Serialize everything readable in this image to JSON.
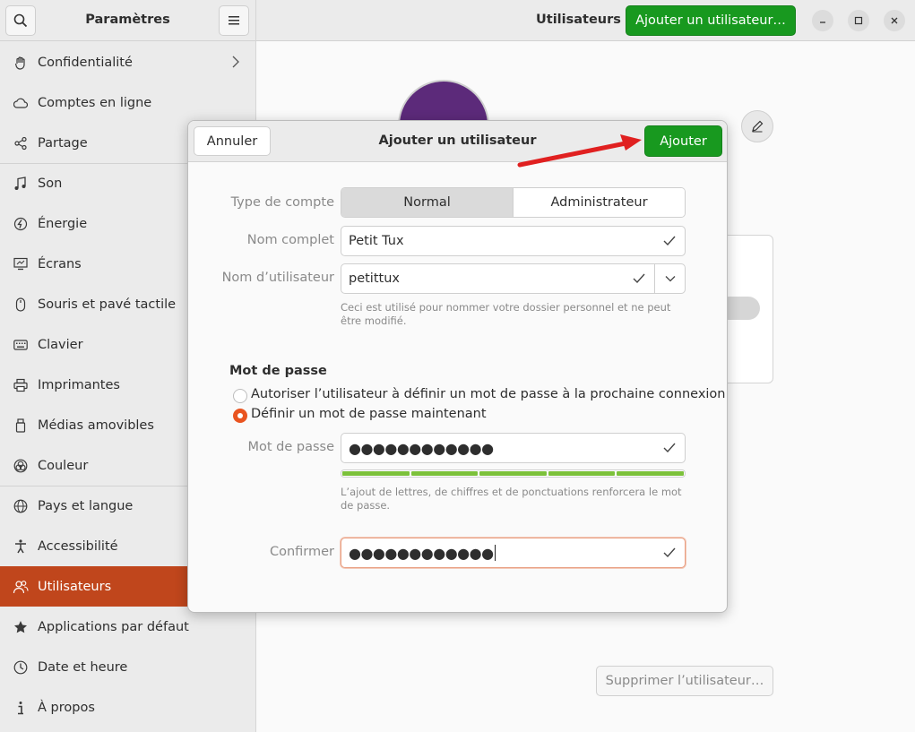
{
  "sidebar": {
    "title": "Paramètres",
    "items": [
      {
        "label": "Confidentialité",
        "icon": "hand-icon"
      },
      {
        "label": "Comptes en ligne",
        "icon": "cloud-icon"
      },
      {
        "label": "Partage",
        "icon": "share-icon"
      },
      {
        "label": "Son",
        "icon": "music-note-icon"
      },
      {
        "label": "Énergie",
        "icon": "power-icon"
      },
      {
        "label": "Écrans",
        "icon": "display-icon"
      },
      {
        "label": "Souris et pavé tactile",
        "icon": "mouse-icon"
      },
      {
        "label": "Clavier",
        "icon": "keyboard-icon"
      },
      {
        "label": "Imprimantes",
        "icon": "printer-icon"
      },
      {
        "label": "Médias amovibles",
        "icon": "usb-icon"
      },
      {
        "label": "Couleur",
        "icon": "color-icon"
      },
      {
        "label": "Pays et langue",
        "icon": "globe-icon"
      },
      {
        "label": "Accessibilité",
        "icon": "accessibility-icon"
      },
      {
        "label": "Utilisateurs",
        "icon": "users-icon"
      },
      {
        "label": "Applications par défaut",
        "icon": "star-icon"
      },
      {
        "label": "Date et heure",
        "icon": "clock-icon"
      },
      {
        "label": "À propos",
        "icon": "info-icon"
      }
    ]
  },
  "header": {
    "title": "Utilisateurs",
    "add_user_label": "Ajouter un utilisateur…"
  },
  "main": {
    "delete_user_label": "Supprimer l’utilisateur…"
  },
  "dialog": {
    "title": "Ajouter un utilisateur",
    "cancel_label": "Annuler",
    "ok_label": "Ajouter",
    "account_type_label": "Type de compte",
    "account_types": [
      "Normal",
      "Administrateur"
    ],
    "fullname_label": "Nom complet",
    "fullname_value": "Petit Tux",
    "username_label": "Nom d’utilisateur",
    "username_value": "petittux",
    "username_hint": "Ceci est utilisé pour nommer votre dossier personnel et ne peut être modifié.",
    "password_section": "Mot de passe",
    "radio_option_1": "Autoriser l’utilisateur à définir un mot de passe à la prochaine connexion",
    "radio_option_2": "Définir un mot de passe maintenant",
    "password_label": "Mot de passe",
    "password_value": "●●●●●●●●●●●●",
    "password_strength": 1.0,
    "password_hint": "L’ajout de lettres, de chiffres et de ponctuations renforcera le mot de passe.",
    "confirm_label": "Confirmer",
    "confirm_value": "●●●●●●●●●●●●"
  },
  "colors": {
    "accent": "#c0461c",
    "success": "#18991f",
    "strength": "#7cc13b",
    "arrow": "#e02020"
  }
}
